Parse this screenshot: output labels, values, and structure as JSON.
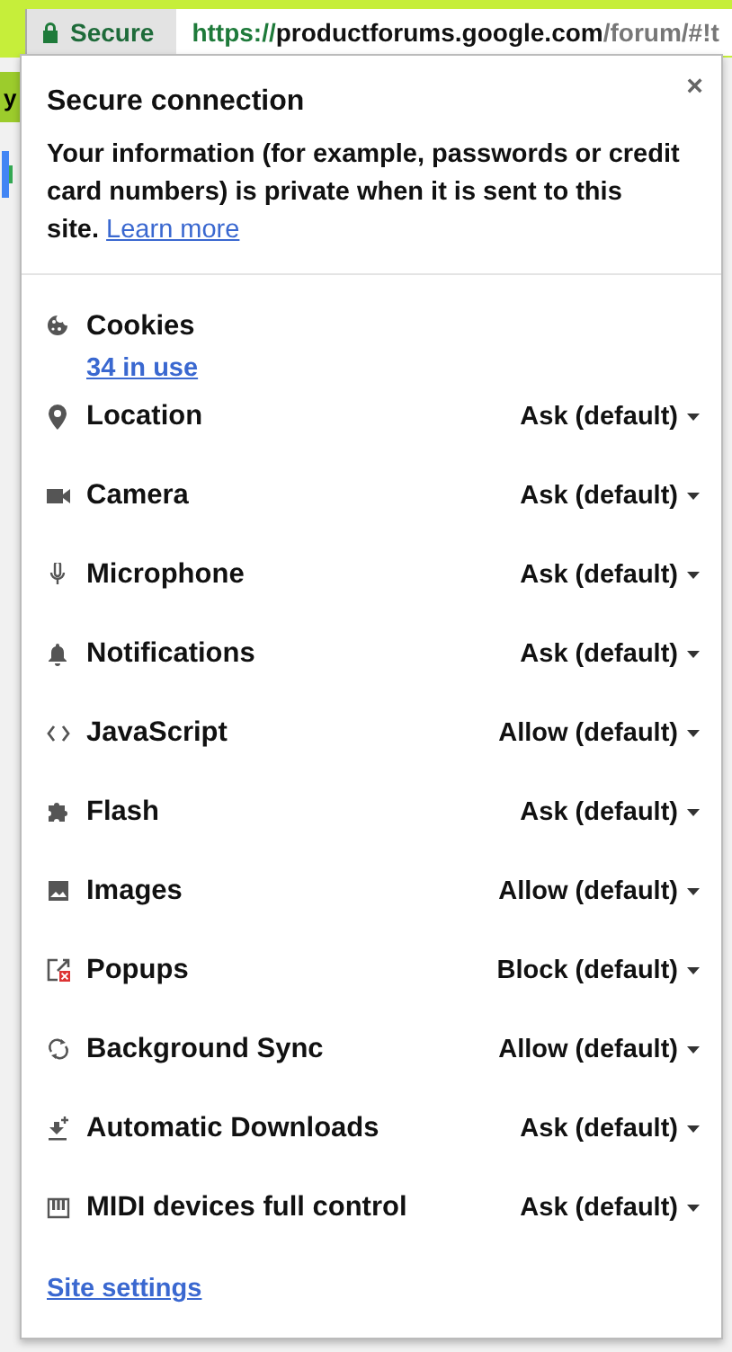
{
  "address_bar": {
    "security_label": "Secure",
    "url_scheme": "https://",
    "url_host": "productforums.google.com",
    "url_path": "/forum/#!t"
  },
  "background_page": {
    "banner_fragment": "y"
  },
  "popup": {
    "title": "Secure connection",
    "description": "Your information (for example, passwords or credit card numbers) is private when it is sent to this site.",
    "learn_more": "Learn more",
    "close": "×",
    "cookies": {
      "label": "Cookies",
      "link": "34 in use"
    },
    "permissions": [
      {
        "kind": "location",
        "label": "Location",
        "value": "Ask (default)"
      },
      {
        "kind": "camera",
        "label": "Camera",
        "value": "Ask (default)"
      },
      {
        "kind": "microphone",
        "label": "Microphone",
        "value": "Ask (default)"
      },
      {
        "kind": "notifications",
        "label": "Notifications",
        "value": "Ask (default)"
      },
      {
        "kind": "javascript",
        "label": "JavaScript",
        "value": "Allow (default)"
      },
      {
        "kind": "flash",
        "label": "Flash",
        "value": "Ask (default)"
      },
      {
        "kind": "images",
        "label": "Images",
        "value": "Allow (default)"
      },
      {
        "kind": "popups",
        "label": "Popups",
        "value": "Block (default)"
      },
      {
        "kind": "sync",
        "label": "Background Sync",
        "value": "Allow (default)"
      },
      {
        "kind": "downloads",
        "label": "Automatic Downloads",
        "value": "Ask (default)"
      },
      {
        "kind": "midi",
        "label": "MIDI devices full control",
        "value": "Ask (default)"
      }
    ],
    "site_settings": "Site settings"
  }
}
